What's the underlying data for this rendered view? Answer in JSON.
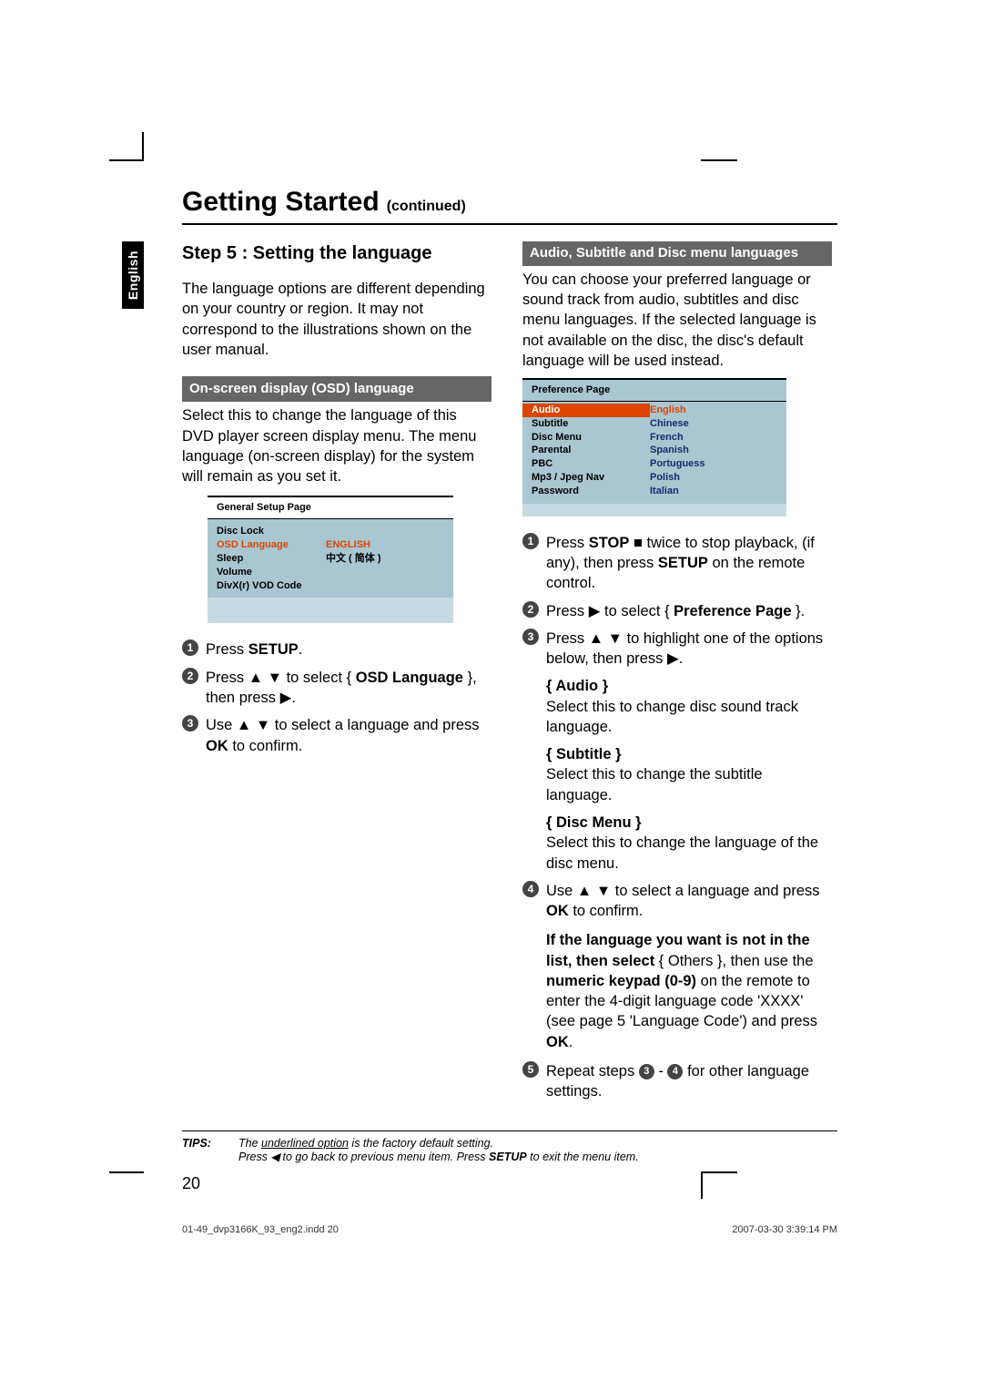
{
  "title": "Getting Started",
  "title_cont": "(continued)",
  "lang_tab": "English",
  "step_heading": "Step 5 :  Setting the language",
  "intro": "The language options are different depending on your country or region. It may not correspond to the illustrations shown on the user manual.",
  "osd_header": "On-screen display (OSD) language",
  "osd_desc": "Select this to change the language of this DVD player screen display menu. The menu language (on-screen display) for the system will remain as you set it.",
  "osd_box": {
    "title": "General Setup Page",
    "rows": [
      {
        "c1": "Disc Lock",
        "c2": "",
        "hl": false
      },
      {
        "c1": "OSD Language",
        "c2": "ENGLISH",
        "hl": true
      },
      {
        "c1": "Sleep",
        "c2": "中文 ( 简体 )",
        "hl": false
      },
      {
        "c1": "Volume",
        "c2": "",
        "hl": false
      },
      {
        "c1": "DivX(r) VOD Code",
        "c2": "",
        "hl": false
      }
    ]
  },
  "osd_steps": {
    "s1_a": "Press ",
    "s1_b": "SETUP",
    "s1_c": ".",
    "s2_a": "Press ▲ ▼ to select { ",
    "s2_b": "OSD Language",
    "s2_c": " }, then press ▶.",
    "s3_a": "Use ▲ ▼ to select a language and press ",
    "s3_b": "OK",
    "s3_c": " to confirm."
  },
  "asd_header": "Audio, Subtitle and Disc menu languages",
  "asd_desc": "You can choose your preferred language or sound track from audio, subtitles and disc menu languages. If the selected language is not available on the disc, the disc's default language will be used instead.",
  "pref_box": {
    "title": "Preference Page",
    "rows": [
      {
        "c1": "Audio",
        "c2": "English",
        "hl": true
      },
      {
        "c1": "Subtitle",
        "c2": "Chinese"
      },
      {
        "c1": "Disc Menu",
        "c2": "French"
      },
      {
        "c1": "Parental",
        "c2": "Spanish"
      },
      {
        "c1": "PBC",
        "c2": "Portuguess"
      },
      {
        "c1": "Mp3 / Jpeg Nav",
        "c2": "Polish"
      },
      {
        "c1": "Password",
        "c2": "Italian"
      }
    ]
  },
  "asd_steps": {
    "s1_a": "Press ",
    "s1_b": "STOP",
    "s1_c": "  ■  twice to stop playback, (if any), then press ",
    "s1_d": "SETUP",
    "s1_e": " on the remote control.",
    "s2_a": "Press ▶ to select { ",
    "s2_b": "Preference Page",
    "s2_c": " }.",
    "s3": "Press ▲ ▼ to highlight one of the options below, then press ▶.",
    "opt_audio_l": "{ Audio }",
    "opt_audio_t": "Select this to change disc sound track language.",
    "opt_sub_l": "{ Subtitle }",
    "opt_sub_t": "Select this to change the subtitle language.",
    "opt_disc_l": "{ Disc Menu }",
    "opt_disc_t": "Select this to change the language of the disc menu.",
    "s4_a": "Use ▲ ▼ to select a language and press ",
    "s4_b": "OK",
    "s4_c": " to confirm.",
    "note_a": "If the language you want is not in the list, then select",
    "note_b": " { Others }, then use the ",
    "note_c": "numeric keypad (0-9)",
    "note_d": " on the remote to enter the 4-digit language code 'XXXX' (see page 5 'Language Code') and press ",
    "note_e": "OK",
    "note_f": ".",
    "s5_a": "Repeat steps ",
    "s5_b": " - ",
    "s5_c": " for other language settings."
  },
  "tips": {
    "label": "TIPS:",
    "l1_a": "The ",
    "l1_b": "underlined option",
    "l1_c": " is the factory default setting.",
    "l2_a": "Press ◀ to go back to previous menu item. Press ",
    "l2_b": "SETUP",
    "l2_c": " to exit the menu item."
  },
  "page_num": "20",
  "footer": {
    "left": "01-49_dvp3166K_93_eng2.indd   20",
    "right": "2007-03-30   3:39:14 PM"
  }
}
